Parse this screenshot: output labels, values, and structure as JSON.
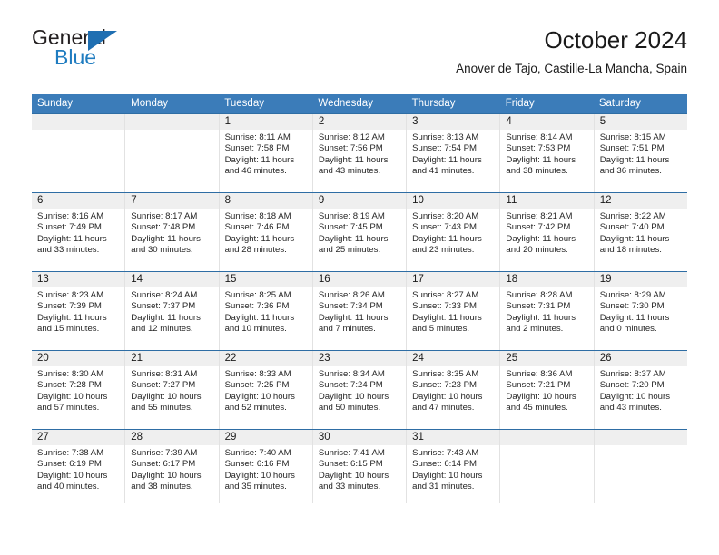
{
  "brand": {
    "name_top": "General",
    "name_bottom": "Blue",
    "triangle_icon": "blue-triangle-logo-mark",
    "accent_color": "#1f7cc0"
  },
  "header": {
    "title": "October 2024",
    "subtitle": "Anover de Tajo, Castille-La Mancha, Spain"
  },
  "colors": {
    "header_blue": "#3b7cb9",
    "week_divider": "#2e6da4",
    "day_strip_gray": "#efefef",
    "cell_border": "#e2e2e2"
  },
  "calendar": {
    "weekday_headers": [
      "Sunday",
      "Monday",
      "Tuesday",
      "Wednesday",
      "Thursday",
      "Friday",
      "Saturday"
    ],
    "weeks": [
      [
        {
          "day": "",
          "empty": true,
          "sunrise": "",
          "sunset": "",
          "daylight_line1": "",
          "daylight_line2": ""
        },
        {
          "day": "",
          "empty": true,
          "sunrise": "",
          "sunset": "",
          "daylight_line1": "",
          "daylight_line2": ""
        },
        {
          "day": "1",
          "empty": false,
          "sunrise": "Sunrise: 8:11 AM",
          "sunset": "Sunset: 7:58 PM",
          "daylight_line1": "Daylight: 11 hours",
          "daylight_line2": "and 46 minutes."
        },
        {
          "day": "2",
          "empty": false,
          "sunrise": "Sunrise: 8:12 AM",
          "sunset": "Sunset: 7:56 PM",
          "daylight_line1": "Daylight: 11 hours",
          "daylight_line2": "and 43 minutes."
        },
        {
          "day": "3",
          "empty": false,
          "sunrise": "Sunrise: 8:13 AM",
          "sunset": "Sunset: 7:54 PM",
          "daylight_line1": "Daylight: 11 hours",
          "daylight_line2": "and 41 minutes."
        },
        {
          "day": "4",
          "empty": false,
          "sunrise": "Sunrise: 8:14 AM",
          "sunset": "Sunset: 7:53 PM",
          "daylight_line1": "Daylight: 11 hours",
          "daylight_line2": "and 38 minutes."
        },
        {
          "day": "5",
          "empty": false,
          "sunrise": "Sunrise: 8:15 AM",
          "sunset": "Sunset: 7:51 PM",
          "daylight_line1": "Daylight: 11 hours",
          "daylight_line2": "and 36 minutes."
        }
      ],
      [
        {
          "day": "6",
          "empty": false,
          "sunrise": "Sunrise: 8:16 AM",
          "sunset": "Sunset: 7:49 PM",
          "daylight_line1": "Daylight: 11 hours",
          "daylight_line2": "and 33 minutes."
        },
        {
          "day": "7",
          "empty": false,
          "sunrise": "Sunrise: 8:17 AM",
          "sunset": "Sunset: 7:48 PM",
          "daylight_line1": "Daylight: 11 hours",
          "daylight_line2": "and 30 minutes."
        },
        {
          "day": "8",
          "empty": false,
          "sunrise": "Sunrise: 8:18 AM",
          "sunset": "Sunset: 7:46 PM",
          "daylight_line1": "Daylight: 11 hours",
          "daylight_line2": "and 28 minutes."
        },
        {
          "day": "9",
          "empty": false,
          "sunrise": "Sunrise: 8:19 AM",
          "sunset": "Sunset: 7:45 PM",
          "daylight_line1": "Daylight: 11 hours",
          "daylight_line2": "and 25 minutes."
        },
        {
          "day": "10",
          "empty": false,
          "sunrise": "Sunrise: 8:20 AM",
          "sunset": "Sunset: 7:43 PM",
          "daylight_line1": "Daylight: 11 hours",
          "daylight_line2": "and 23 minutes."
        },
        {
          "day": "11",
          "empty": false,
          "sunrise": "Sunrise: 8:21 AM",
          "sunset": "Sunset: 7:42 PM",
          "daylight_line1": "Daylight: 11 hours",
          "daylight_line2": "and 20 minutes."
        },
        {
          "day": "12",
          "empty": false,
          "sunrise": "Sunrise: 8:22 AM",
          "sunset": "Sunset: 7:40 PM",
          "daylight_line1": "Daylight: 11 hours",
          "daylight_line2": "and 18 minutes."
        }
      ],
      [
        {
          "day": "13",
          "empty": false,
          "sunrise": "Sunrise: 8:23 AM",
          "sunset": "Sunset: 7:39 PM",
          "daylight_line1": "Daylight: 11 hours",
          "daylight_line2": "and 15 minutes."
        },
        {
          "day": "14",
          "empty": false,
          "sunrise": "Sunrise: 8:24 AM",
          "sunset": "Sunset: 7:37 PM",
          "daylight_line1": "Daylight: 11 hours",
          "daylight_line2": "and 12 minutes."
        },
        {
          "day": "15",
          "empty": false,
          "sunrise": "Sunrise: 8:25 AM",
          "sunset": "Sunset: 7:36 PM",
          "daylight_line1": "Daylight: 11 hours",
          "daylight_line2": "and 10 minutes."
        },
        {
          "day": "16",
          "empty": false,
          "sunrise": "Sunrise: 8:26 AM",
          "sunset": "Sunset: 7:34 PM",
          "daylight_line1": "Daylight: 11 hours",
          "daylight_line2": "and 7 minutes."
        },
        {
          "day": "17",
          "empty": false,
          "sunrise": "Sunrise: 8:27 AM",
          "sunset": "Sunset: 7:33 PM",
          "daylight_line1": "Daylight: 11 hours",
          "daylight_line2": "and 5 minutes."
        },
        {
          "day": "18",
          "empty": false,
          "sunrise": "Sunrise: 8:28 AM",
          "sunset": "Sunset: 7:31 PM",
          "daylight_line1": "Daylight: 11 hours",
          "daylight_line2": "and 2 minutes."
        },
        {
          "day": "19",
          "empty": false,
          "sunrise": "Sunrise: 8:29 AM",
          "sunset": "Sunset: 7:30 PM",
          "daylight_line1": "Daylight: 11 hours",
          "daylight_line2": "and 0 minutes."
        }
      ],
      [
        {
          "day": "20",
          "empty": false,
          "sunrise": "Sunrise: 8:30 AM",
          "sunset": "Sunset: 7:28 PM",
          "daylight_line1": "Daylight: 10 hours",
          "daylight_line2": "and 57 minutes."
        },
        {
          "day": "21",
          "empty": false,
          "sunrise": "Sunrise: 8:31 AM",
          "sunset": "Sunset: 7:27 PM",
          "daylight_line1": "Daylight: 10 hours",
          "daylight_line2": "and 55 minutes."
        },
        {
          "day": "22",
          "empty": false,
          "sunrise": "Sunrise: 8:33 AM",
          "sunset": "Sunset: 7:25 PM",
          "daylight_line1": "Daylight: 10 hours",
          "daylight_line2": "and 52 minutes."
        },
        {
          "day": "23",
          "empty": false,
          "sunrise": "Sunrise: 8:34 AM",
          "sunset": "Sunset: 7:24 PM",
          "daylight_line1": "Daylight: 10 hours",
          "daylight_line2": "and 50 minutes."
        },
        {
          "day": "24",
          "empty": false,
          "sunrise": "Sunrise: 8:35 AM",
          "sunset": "Sunset: 7:23 PM",
          "daylight_line1": "Daylight: 10 hours",
          "daylight_line2": "and 47 minutes."
        },
        {
          "day": "25",
          "empty": false,
          "sunrise": "Sunrise: 8:36 AM",
          "sunset": "Sunset: 7:21 PM",
          "daylight_line1": "Daylight: 10 hours",
          "daylight_line2": "and 45 minutes."
        },
        {
          "day": "26",
          "empty": false,
          "sunrise": "Sunrise: 8:37 AM",
          "sunset": "Sunset: 7:20 PM",
          "daylight_line1": "Daylight: 10 hours",
          "daylight_line2": "and 43 minutes."
        }
      ],
      [
        {
          "day": "27",
          "empty": false,
          "sunrise": "Sunrise: 7:38 AM",
          "sunset": "Sunset: 6:19 PM",
          "daylight_line1": "Daylight: 10 hours",
          "daylight_line2": "and 40 minutes."
        },
        {
          "day": "28",
          "empty": false,
          "sunrise": "Sunrise: 7:39 AM",
          "sunset": "Sunset: 6:17 PM",
          "daylight_line1": "Daylight: 10 hours",
          "daylight_line2": "and 38 minutes."
        },
        {
          "day": "29",
          "empty": false,
          "sunrise": "Sunrise: 7:40 AM",
          "sunset": "Sunset: 6:16 PM",
          "daylight_line1": "Daylight: 10 hours",
          "daylight_line2": "and 35 minutes."
        },
        {
          "day": "30",
          "empty": false,
          "sunrise": "Sunrise: 7:41 AM",
          "sunset": "Sunset: 6:15 PM",
          "daylight_line1": "Daylight: 10 hours",
          "daylight_line2": "and 33 minutes."
        },
        {
          "day": "31",
          "empty": false,
          "sunrise": "Sunrise: 7:43 AM",
          "sunset": "Sunset: 6:14 PM",
          "daylight_line1": "Daylight: 10 hours",
          "daylight_line2": "and 31 minutes."
        },
        {
          "day": "",
          "empty": true,
          "sunrise": "",
          "sunset": "",
          "daylight_line1": "",
          "daylight_line2": ""
        },
        {
          "day": "",
          "empty": true,
          "sunrise": "",
          "sunset": "",
          "daylight_line1": "",
          "daylight_line2": ""
        }
      ]
    ]
  }
}
